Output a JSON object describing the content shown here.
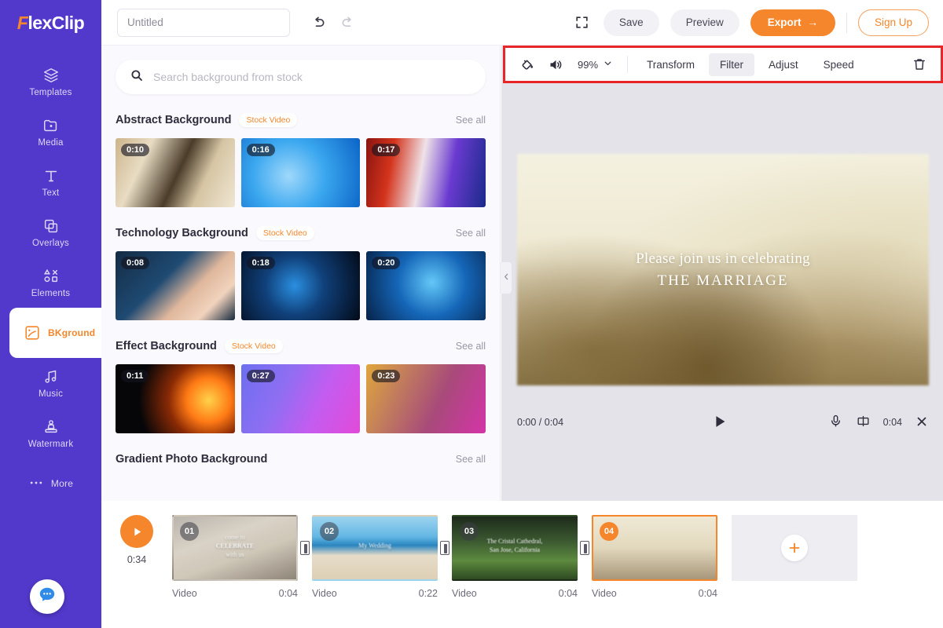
{
  "app": {
    "name": "FlexClip",
    "logo_first_letter": "F",
    "logo_rest": "lexClip"
  },
  "sidebar": {
    "items": [
      {
        "label": "Templates",
        "icon": "layers-icon",
        "active": false
      },
      {
        "label": "Media",
        "icon": "media-folder-icon",
        "active": false
      },
      {
        "label": "Text",
        "icon": "text-t-icon",
        "active": false
      },
      {
        "label": "Overlays",
        "icon": "overlays-icon",
        "active": false
      },
      {
        "label": "Elements",
        "icon": "elements-shapes-icon",
        "active": false
      },
      {
        "label": "BKground",
        "icon": "background-icon",
        "active": true
      },
      {
        "label": "Music",
        "icon": "music-note-icon",
        "active": false
      },
      {
        "label": "Watermark",
        "icon": "watermark-stamp-icon",
        "active": false
      },
      {
        "label": "More",
        "icon": "ellipsis-icon",
        "active": false
      }
    ],
    "chat_button": "chat-bubble-icon"
  },
  "topbar": {
    "project_title_value": "Untitled",
    "project_title_placeholder": "Untitled",
    "undo_icon": "undo-arrow-icon",
    "redo_icon": "redo-arrow-icon",
    "fullscreen_icon": "fullscreen-icon",
    "save_label": "Save",
    "preview_label": "Preview",
    "export_label": "Export",
    "export_arrow": "→",
    "signup_label": "Sign Up"
  },
  "search": {
    "placeholder": "Search background from stock",
    "icon": "search-icon"
  },
  "library": {
    "see_all_label": "See all",
    "stock_badge": "Stock Video",
    "sections": [
      {
        "title": "Abstract Background",
        "badge": "Stock Video",
        "items": [
          {
            "duration": "0:10",
            "art": "art-abs1"
          },
          {
            "duration": "0:16",
            "art": "art-abs2"
          },
          {
            "duration": "0:17",
            "art": "art-abs3"
          }
        ]
      },
      {
        "title": "Technology Background",
        "badge": "Stock Video",
        "items": [
          {
            "duration": "0:08",
            "art": "art-tec1"
          },
          {
            "duration": "0:18",
            "art": "art-tec2"
          },
          {
            "duration": "0:20",
            "art": "art-tec3"
          }
        ]
      },
      {
        "title": "Effect Background",
        "badge": "Stock Video",
        "items": [
          {
            "duration": "0:11",
            "art": "art-eff1"
          },
          {
            "duration": "0:27",
            "art": "art-eff2"
          },
          {
            "duration": "0:23",
            "art": "art-eff3"
          }
        ]
      },
      {
        "title": "Gradient Photo Background",
        "badge": "",
        "items": []
      }
    ],
    "collapse_icon": "chevron-left-icon"
  },
  "clip_toolbar": {
    "highlighted": true,
    "highlight_color": "#e8262a",
    "fill_icon": "paint-bucket-icon",
    "volume_icon": "volume-icon",
    "zoom_value": "99%",
    "zoom_chevron": "chevron-down-icon",
    "tabs": [
      {
        "label": "Transform",
        "active": false
      },
      {
        "label": "Filter",
        "active": true
      },
      {
        "label": "Adjust",
        "active": false
      },
      {
        "label": "Speed",
        "active": false
      }
    ],
    "delete_icon": "trash-icon"
  },
  "preview": {
    "text_line1": "Please join us in celebrating",
    "text_line2": "THE MARRIAGE",
    "current_time": "0:00",
    "total_time": "0:04",
    "time_display": "0:00 / 0:04",
    "play_icon": "play-icon",
    "mic_icon": "microphone-icon",
    "aspect_icon": "aspect-ratio-icon",
    "clip_duration": "0:04",
    "close_icon": "close-x-icon"
  },
  "timeline": {
    "play_icon": "play-circle-icon",
    "total_duration": "0:34",
    "transition_icon": "transition-icon",
    "add_icon": "plus-icon",
    "clips": [
      {
        "number": "01",
        "type_label": "Video",
        "duration": "0:04",
        "art": "art-c1",
        "overlay_text": "come to<br>CELEBRATE<br>with us",
        "selected": false
      },
      {
        "number": "02",
        "type_label": "Video",
        "duration": "0:22",
        "art": "art-c2",
        "overlay_text": "My Wedding",
        "selected": false
      },
      {
        "number": "03",
        "type_label": "Video",
        "duration": "0:04",
        "art": "art-c3",
        "overlay_text": "The Cristal Cathedral,<br>San Jose, California",
        "selected": false
      },
      {
        "number": "04",
        "type_label": "Video",
        "duration": "0:04",
        "art": "art-c4",
        "overlay_text": "",
        "selected": true
      }
    ]
  },
  "colors": {
    "sidebar_purple": "#5239cc",
    "accent_orange": "#f5862b",
    "highlight_red": "#e8262a",
    "panel_bg": "#faf9fd"
  }
}
